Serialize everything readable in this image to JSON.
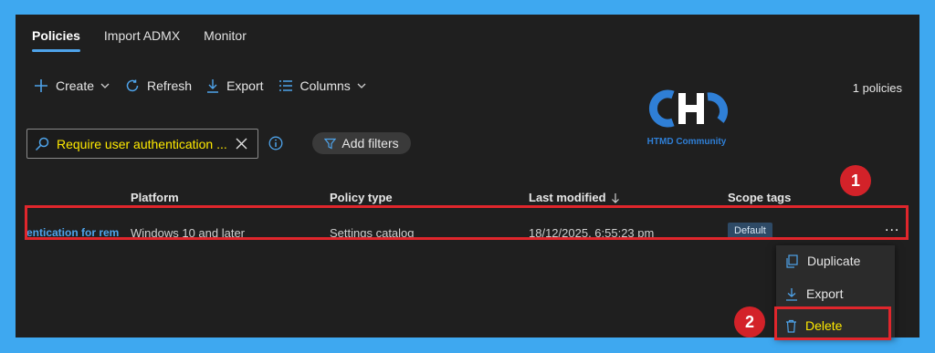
{
  "tabs": [
    {
      "label": "Policies"
    },
    {
      "label": "Import ADMX"
    },
    {
      "label": "Monitor"
    }
  ],
  "toolbar": {
    "create_label": "Create",
    "refresh_label": "Refresh",
    "export_label": "Export",
    "columns_label": "Columns"
  },
  "policy_count": "1 policies",
  "logo": {
    "text": "HTMD Community"
  },
  "search": {
    "value": "Require user authentication ..."
  },
  "filters": {
    "add_label": "Add filters"
  },
  "table": {
    "headers": {
      "platform": "Platform",
      "policy_type": "Policy type",
      "last_modified": "Last modified",
      "scope_tags": "Scope tags"
    },
    "rows": [
      {
        "name": "entication for rem",
        "platform": "Windows 10 and later",
        "policy_type": "Settings catalog",
        "last_modified": "18/12/2025, 6:55:23 pm",
        "scope_tag": "Default",
        "more": "..."
      }
    ]
  },
  "annotations": {
    "step1": "1",
    "step2": "2"
  },
  "context_menu": {
    "duplicate": "Duplicate",
    "export": "Export",
    "delete": "Delete"
  },
  "colors": {
    "frame_border": "#3ea8f0",
    "background": "#1f1f1f",
    "accent": "#4ea3ea",
    "highlight": "#e0262c",
    "search_text": "#ffea00"
  },
  "icons": [
    "plus-icon",
    "chevron-down-icon",
    "refresh-icon",
    "download-icon",
    "columns-icon",
    "search-icon",
    "close-icon",
    "info-icon",
    "filter-icon",
    "duplicate-icon",
    "trash-icon",
    "more-icon"
  ]
}
